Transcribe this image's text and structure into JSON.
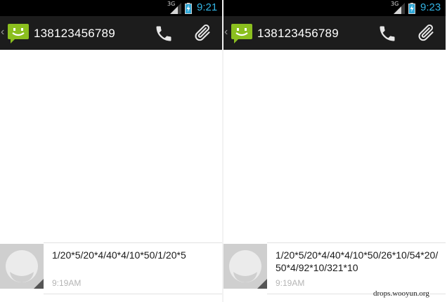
{
  "screens": [
    {
      "status": {
        "network": "3G",
        "time": "9:21"
      },
      "header": {
        "title": "138123456789"
      },
      "message": {
        "text": "1/20*5/20*4/40*4/10*50/1/20*5",
        "time": "9:19AM"
      }
    },
    {
      "status": {
        "network": "3G",
        "time": "9:23"
      },
      "header": {
        "title": "138123456789"
      },
      "message": {
        "text": "1/20*5/20*4/40*4/10*50/26*10/54*20/50*4/92*10/321*10",
        "time": "9:19AM"
      }
    }
  ],
  "icons": {
    "back": "chevron-left-icon",
    "app": "messaging-app-icon",
    "call": "phone-icon",
    "attach": "paperclip-icon",
    "avatar": "default-contact-avatar-icon",
    "signal": "signal-icon",
    "battery": "battery-charging-icon"
  },
  "colors": {
    "status_bar": "#000000",
    "action_bar": "#1c1c1c",
    "clock": "#33b5e5",
    "app_icon": "#8bbf1f",
    "timestamp": "#b5b5b5"
  },
  "watermark": "drops.wooyun.org"
}
